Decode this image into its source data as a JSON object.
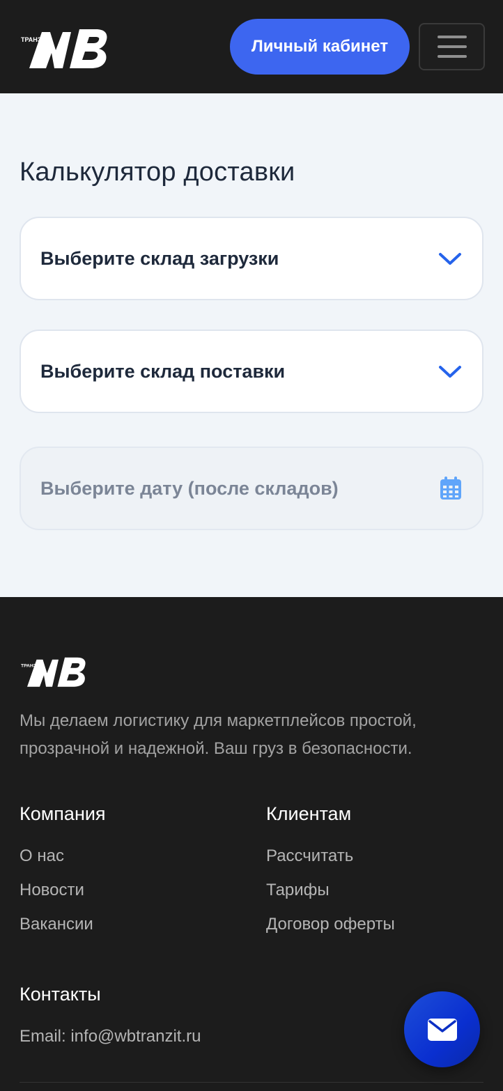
{
  "header": {
    "logo_small_text": "ТРАНЗИТ",
    "logo_letters": "WB",
    "cabinet_label": "Личный кабинет"
  },
  "calculator": {
    "title": "Калькулятор доставки",
    "fields": [
      {
        "label": "Выберите склад загрузки",
        "icon": "chevron-down-icon",
        "disabled": false
      },
      {
        "label": "Выберите склад поставки",
        "icon": "chevron-down-icon",
        "disabled": false
      },
      {
        "label": "Выберите дату (после складов)",
        "icon": "calendar-icon",
        "disabled": true
      }
    ]
  },
  "footer": {
    "tagline": "Мы делаем логистику для маркетплейсов простой, прозрачной и надежной. Ваш груз в безопасности.",
    "company": {
      "title": "Компания",
      "links": [
        "О нас",
        "Новости",
        "Вакансии"
      ]
    },
    "clients": {
      "title": "Клиентам",
      "links": [
        "Рассчитать",
        "Тарифы",
        "Договор оферты"
      ]
    },
    "contacts": {
      "title": "Контакты",
      "email": "Email: info@wbtranzit.ru"
    }
  },
  "colors": {
    "accent": "#3d66f0",
    "dark_bg": "#1c1c1c",
    "light_bg": "#f1f5f9",
    "icon_blue": "#2563eb"
  },
  "fab_icon": "mail-icon"
}
